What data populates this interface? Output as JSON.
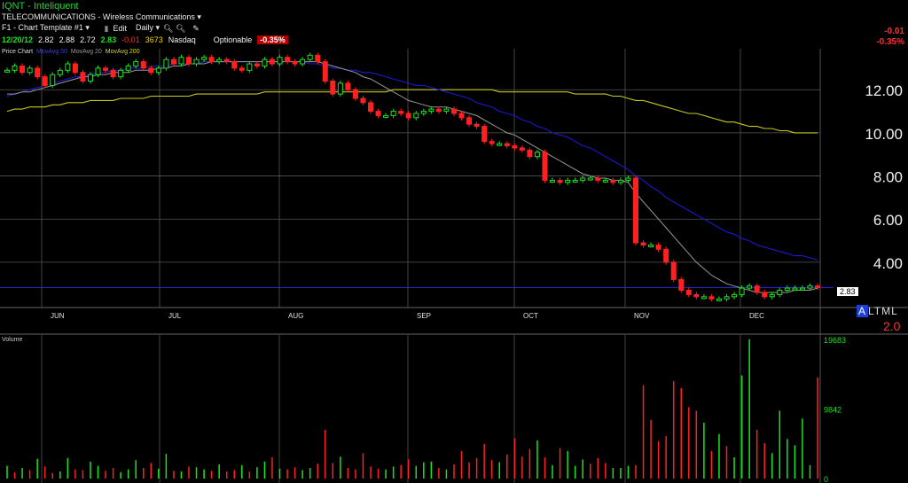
{
  "header": {
    "ticker_title": "IQNT - Inteliquent",
    "sector": "TELECOMMUNICATIONS - Wireless Communications",
    "template": "F1 - Chart Template #1",
    "edit_label": "Edit",
    "period": "Daily",
    "quote": {
      "date": "12/20/12",
      "open": "2.82",
      "high": "2.88",
      "low": "2.72",
      "close": "2.83",
      "change": "-0.01",
      "volume": "3673",
      "exchange": "Nasdaq",
      "optionable": "Optionable",
      "pct_change": "-0.35%"
    },
    "right_change": "-0.01",
    "right_pct": "-0.35%"
  },
  "legend": {
    "price": "Price Chart",
    "ma50": "MovAvg 50",
    "ma20": "MovAvg 20",
    "ma200": "MovAvg 200"
  },
  "volume_label": "Volume",
  "altml": {
    "a": "A",
    "rest": "LTML",
    "value": "2.0"
  },
  "last_price": "2.83",
  "colors": {
    "up": "#19e619",
    "down": "#ff2020",
    "ma20": "#9a9a9a",
    "ma50": "#1a1ad0",
    "ma200": "#c8c81a",
    "grid": "#555555"
  },
  "chart_data": [
    {
      "type": "line",
      "title": "Price Chart",
      "x_labels": [
        "JUN",
        "JUL",
        "AUG",
        "SEP",
        "OCT",
        "NOV",
        "DEC"
      ],
      "y_tick_labels": [
        "12.00",
        "10.00",
        "8.00",
        "6.00",
        "4.00"
      ],
      "y_ticks": [
        12,
        10,
        8,
        6,
        4
      ],
      "ylim": [
        1.9,
        13.9
      ],
      "grid": true,
      "last_price_line": 2.83,
      "close": [
        12.9,
        13.1,
        12.8,
        13.0,
        12.6,
        12.2,
        12.7,
        12.9,
        13.2,
        12.8,
        12.4,
        12.7,
        13.0,
        12.9,
        12.6,
        12.9,
        13.1,
        13.3,
        13.0,
        12.8,
        13.0,
        13.4,
        13.2,
        13.5,
        13.2,
        13.4,
        13.5,
        13.3,
        13.4,
        13.3,
        13.0,
        12.9,
        13.2,
        13.1,
        13.4,
        13.2,
        13.5,
        13.3,
        13.2,
        13.4,
        13.6,
        13.3,
        12.4,
        11.8,
        12.3,
        12.0,
        11.6,
        11.4,
        11.0,
        10.8,
        10.8,
        11.0,
        10.9,
        10.7,
        10.9,
        11.0,
        11.1,
        11.0,
        11.1,
        10.9,
        10.7,
        10.4,
        10.3,
        9.6,
        9.5,
        9.5,
        9.4,
        9.3,
        9.2,
        8.9,
        9.1,
        7.8,
        7.8,
        7.7,
        7.8,
        7.8,
        7.9,
        7.9,
        7.8,
        7.8,
        7.7,
        7.8,
        7.9,
        4.9,
        4.8,
        4.8,
        4.6,
        4.0,
        3.2,
        2.7,
        2.5,
        2.4,
        2.4,
        2.3,
        2.3,
        2.4,
        2.5,
        2.8,
        2.9,
        2.6,
        2.4,
        2.5,
        2.7,
        2.8,
        2.8,
        2.8,
        2.9,
        2.83
      ],
      "ma20": [
        11.8,
        11.8,
        11.9,
        11.9,
        12.0,
        12.1,
        12.2,
        12.3,
        12.4,
        12.5,
        12.6,
        12.6,
        12.7,
        12.7,
        12.8,
        12.8,
        12.8,
        12.9,
        12.9,
        12.9,
        13.0,
        13.0,
        13.1,
        13.1,
        13.2,
        13.2,
        13.2,
        13.3,
        13.3,
        13.3,
        13.3,
        13.3,
        13.3,
        13.3,
        13.3,
        13.3,
        13.3,
        13.3,
        13.3,
        13.3,
        13.3,
        13.3,
        13.2,
        13.1,
        13.0,
        12.9,
        12.8,
        12.6,
        12.5,
        12.3,
        12.1,
        11.9,
        11.7,
        11.5,
        11.4,
        11.3,
        11.2,
        11.2,
        11.2,
        11.1,
        11.0,
        10.9,
        10.8,
        10.6,
        10.4,
        10.2,
        10.0,
        9.9,
        9.7,
        9.5,
        9.3,
        9.1,
        8.9,
        8.7,
        8.5,
        8.3,
        8.1,
        8.0,
        7.9,
        7.9,
        7.8,
        7.8,
        7.7,
        7.2,
        6.8,
        6.4,
        6.0,
        5.6,
        5.2,
        4.8,
        4.4,
        4.0,
        3.7,
        3.4,
        3.2,
        3.0,
        2.9,
        2.8,
        2.7,
        2.6,
        2.6,
        2.6,
        2.6,
        2.6,
        2.7,
        2.7,
        2.7,
        2.8
      ],
      "ma50": [
        11.7,
        11.8,
        11.9,
        12.0,
        12.1,
        12.2,
        12.3,
        12.4,
        12.5,
        12.6,
        12.6,
        12.7,
        12.8,
        12.8,
        12.9,
        12.9,
        13.0,
        13.0,
        13.0,
        13.1,
        13.1,
        13.1,
        13.2,
        13.2,
        13.2,
        13.2,
        13.3,
        13.3,
        13.3,
        13.3,
        13.3,
        13.3,
        13.3,
        13.3,
        13.3,
        13.3,
        13.3,
        13.3,
        13.3,
        13.3,
        13.2,
        13.2,
        13.1,
        13.0,
        13.0,
        12.9,
        12.9,
        12.8,
        12.8,
        12.7,
        12.6,
        12.5,
        12.4,
        12.3,
        12.2,
        12.2,
        12.1,
        12.0,
        11.9,
        11.8,
        11.7,
        11.6,
        11.4,
        11.3,
        11.2,
        11.0,
        10.9,
        10.8,
        10.6,
        10.5,
        10.3,
        10.2,
        10.0,
        9.9,
        9.8,
        9.6,
        9.4,
        9.3,
        9.1,
        8.9,
        8.7,
        8.5,
        8.3,
        8.0,
        7.8,
        7.5,
        7.3,
        7.0,
        6.8,
        6.6,
        6.4,
        6.2,
        6.0,
        5.8,
        5.6,
        5.4,
        5.3,
        5.1,
        5.0,
        4.8,
        4.7,
        4.6,
        4.5,
        4.4,
        4.3,
        4.3,
        4.2,
        4.1
      ],
      "ma200": [
        11.0,
        11.1,
        11.1,
        11.2,
        11.2,
        11.2,
        11.3,
        11.3,
        11.4,
        11.4,
        11.4,
        11.5,
        11.5,
        11.5,
        11.5,
        11.6,
        11.6,
        11.6,
        11.6,
        11.7,
        11.7,
        11.7,
        11.7,
        11.7,
        11.7,
        11.8,
        11.8,
        11.8,
        11.8,
        11.8,
        11.8,
        11.8,
        11.8,
        11.8,
        11.9,
        11.9,
        11.9,
        11.9,
        11.9,
        11.9,
        11.9,
        11.9,
        11.9,
        11.9,
        11.9,
        11.9,
        11.9,
        11.9,
        11.9,
        11.9,
        11.9,
        12.0,
        12.0,
        12.0,
        12.0,
        12.0,
        12.0,
        12.0,
        12.0,
        12.0,
        12.0,
        12.0,
        12.0,
        12.0,
        12.0,
        11.9,
        11.9,
        11.9,
        11.9,
        11.9,
        11.9,
        11.9,
        11.9,
        11.9,
        11.9,
        11.8,
        11.8,
        11.8,
        11.8,
        11.8,
        11.7,
        11.7,
        11.6,
        11.5,
        11.5,
        11.4,
        11.3,
        11.2,
        11.1,
        11.0,
        10.9,
        10.9,
        10.8,
        10.7,
        10.6,
        10.5,
        10.5,
        10.4,
        10.3,
        10.3,
        10.2,
        10.2,
        10.1,
        10.1,
        10.0,
        10.0,
        10.0,
        10.0
      ]
    },
    {
      "type": "bar",
      "title": "Volume",
      "y_tick_labels": [
        "19683",
        "9842",
        "0"
      ],
      "y_ticks": [
        19683,
        9842,
        0
      ],
      "ylim": [
        0,
        19683
      ],
      "values": [
        1800,
        900,
        1500,
        1200,
        2800,
        1700,
        800,
        1000,
        2900,
        1300,
        1200,
        2400,
        1800,
        1100,
        1500,
        900,
        1300,
        2600,
        1500,
        2200,
        1400,
        3500,
        1100,
        1000,
        1700,
        1600,
        1300,
        1100,
        2000,
        1000,
        1200,
        1900,
        1000,
        1600,
        2400,
        3000,
        1400,
        1300,
        1600,
        1200,
        1500,
        2100,
        6900,
        2200,
        3100,
        1500,
        1300,
        3600,
        1700,
        1400,
        1300,
        1700,
        1900,
        2700,
        1800,
        2300,
        2400,
        1500,
        1300,
        2000,
        3900,
        2300,
        2900,
        4900,
        2600,
        2300,
        3400,
        5700,
        3100,
        4200,
        5400,
        3000,
        1900,
        4300,
        3900,
        1800,
        2700,
        2100,
        2900,
        2200,
        1500,
        1500,
        1800,
        1900,
        13200,
        8300,
        5300,
        6000,
        13800,
        12800,
        10100,
        9600,
        7900,
        3900,
        6300,
        4600,
        3000,
        14600,
        19700,
        6900,
        5000,
        3600,
        9600,
        5600,
        4700,
        8500,
        1900,
        14300
      ],
      "up": [
        true,
        false,
        true,
        false,
        true,
        false,
        false,
        true,
        true,
        false,
        false,
        true,
        true,
        false,
        false,
        true,
        true,
        true,
        false,
        false,
        true,
        true,
        false,
        true,
        false,
        true,
        true,
        false,
        true,
        false,
        false,
        true,
        false,
        true,
        true,
        false,
        true,
        false,
        false,
        true,
        true,
        false,
        false,
        false,
        true,
        false,
        false,
        false,
        false,
        false,
        true,
        true,
        false,
        false,
        true,
        true,
        true,
        false,
        true,
        false,
        false,
        false,
        false,
        false,
        false,
        true,
        false,
        false,
        false,
        false,
        true,
        false,
        true,
        false,
        true,
        true,
        true,
        false,
        false,
        false,
        true,
        true,
        true,
        false,
        false,
        false,
        false,
        false,
        false,
        false,
        false,
        false,
        true,
        false,
        true,
        false,
        true,
        true,
        true,
        false,
        false,
        true,
        true,
        true,
        true,
        true,
        true,
        false
      ]
    }
  ]
}
